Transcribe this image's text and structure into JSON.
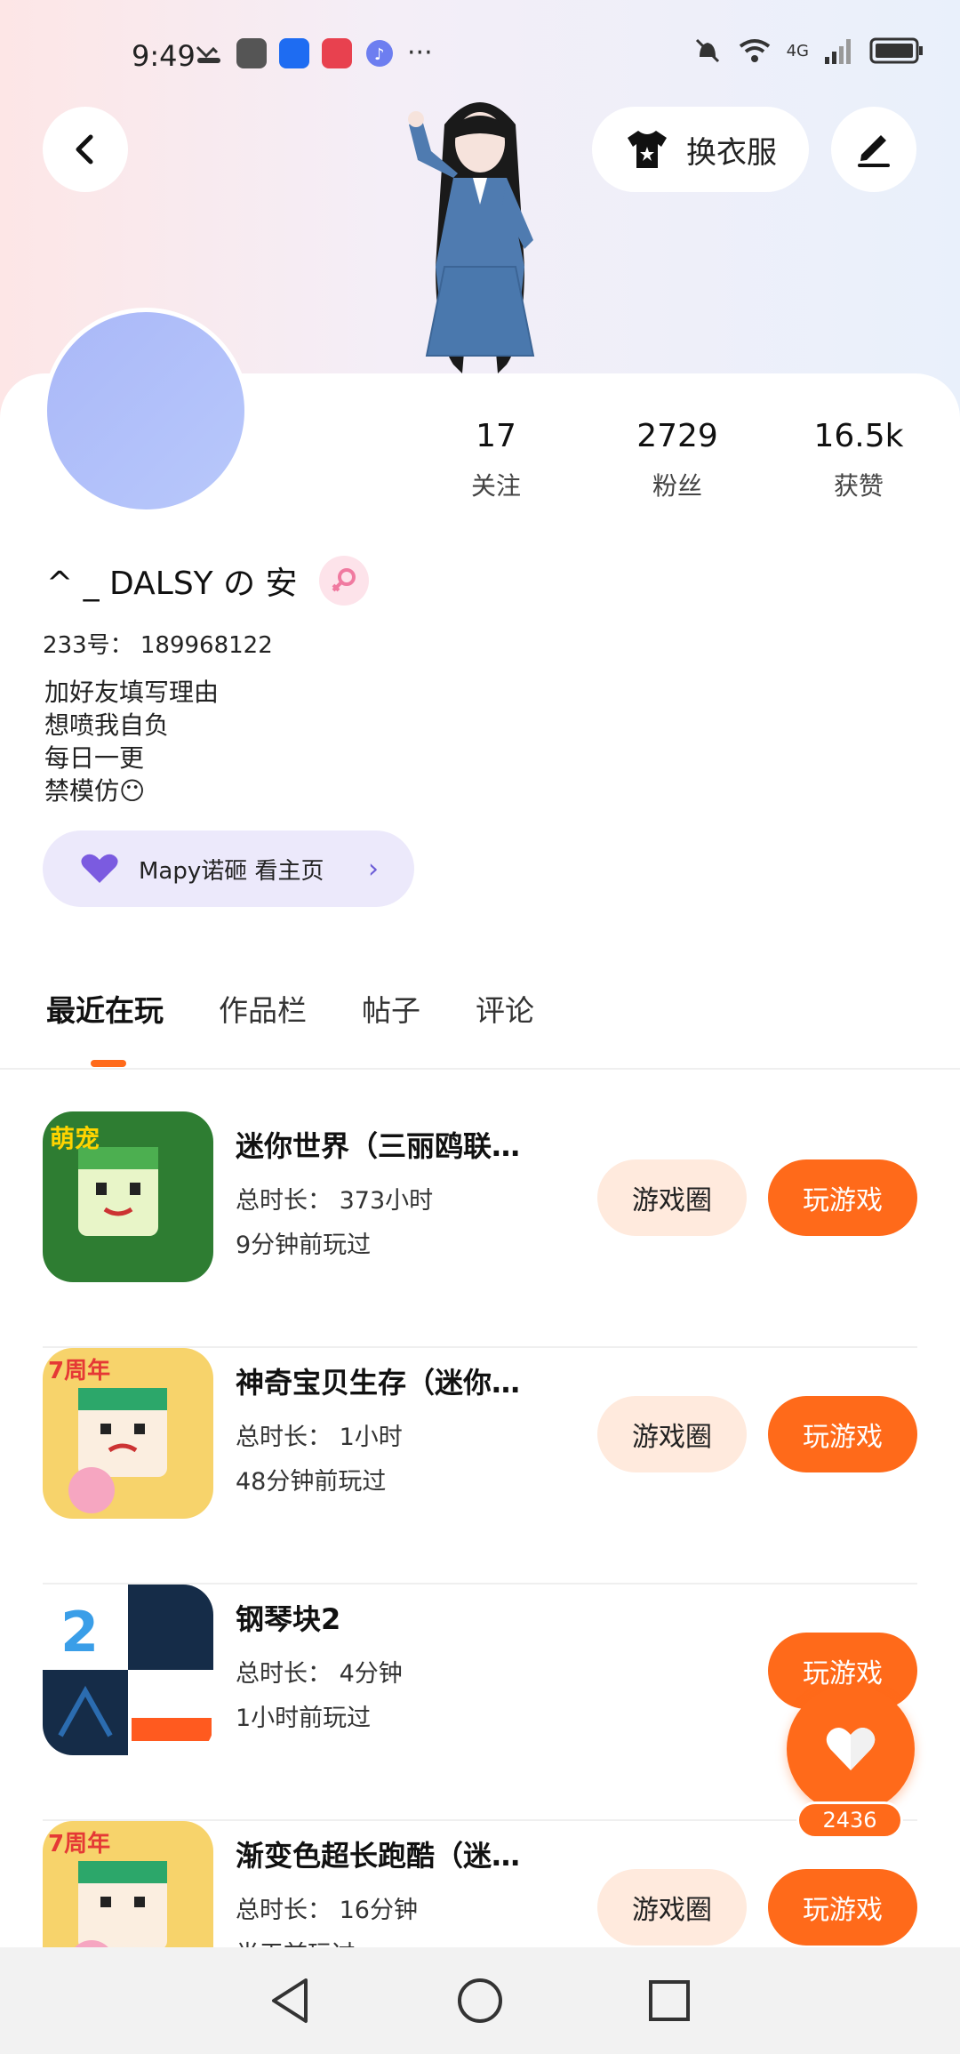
{
  "status_bar": {
    "time": "9:49",
    "signal_label": "4G"
  },
  "header": {
    "outfit_label": "换衣服"
  },
  "profile": {
    "stats": [
      {
        "value": "17",
        "label": "关注"
      },
      {
        "value": "2729",
        "label": "粉丝"
      },
      {
        "value": "16.5k",
        "label": "获赞"
      }
    ],
    "username": "^ _ DALSY の 安",
    "uid": "233号： 189968122",
    "bio": [
      "加好友填写理由",
      "想喷我自负",
      "每日一更",
      "禁模仿😶"
    ],
    "app_link_label": "Mapy诺砸 看主页"
  },
  "tabs": [
    {
      "label": "最近在玩",
      "active": true
    },
    {
      "label": "作品栏",
      "active": false
    },
    {
      "label": "帖子",
      "active": false
    },
    {
      "label": "评论",
      "active": false
    }
  ],
  "games": [
    {
      "title": "迷你世界（三丽鸥联…",
      "duration": "总时长： 373小时",
      "last_played": "9分钟前玩过",
      "circle_label": "游戏圈",
      "play_label": "玩游戏",
      "has_circle": true,
      "icon_badge": "萌宠"
    },
    {
      "title": "神奇宝贝生存（迷你…",
      "duration": "总时长： 1小时",
      "last_played": "48分钟前玩过",
      "circle_label": "游戏圈",
      "play_label": "玩游戏",
      "has_circle": true,
      "icon_badge": "7周年"
    },
    {
      "title": "钢琴块2",
      "duration": "总时长： 4分钟",
      "last_played": "1小时前玩过",
      "circle_label": "",
      "play_label": "玩游戏",
      "has_circle": false,
      "icon_badge": "2"
    },
    {
      "title": "渐变色超长跑酷（迷…",
      "duration": "总时长： 16分钟",
      "last_played": "半天前玩过",
      "circle_label": "游戏圈",
      "play_label": "玩游戏",
      "has_circle": true,
      "icon_badge": "7周年"
    }
  ],
  "like": {
    "count": "2436"
  },
  "colors": {
    "accent": "#ff6a1a",
    "accent_light": "#ffeadd",
    "avatar": "#b0c0fa",
    "link_bg": "#ece9fb"
  }
}
